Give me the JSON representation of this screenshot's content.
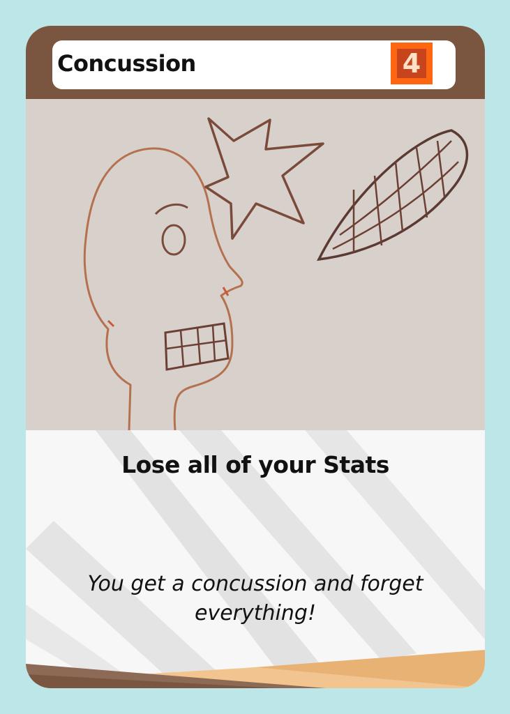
{
  "card": {
    "title": "Concussion",
    "cost": "4",
    "effect": "Lose all of your Stats",
    "flavor": "You get a concussion and forget everything!",
    "artwork_icon": "head-star-football-drawing-icon"
  },
  "colors": {
    "background": "#bde6e8",
    "header": "#7a5640",
    "cost": "#ff6611",
    "footer_tan": "#e9b275",
    "footer_brown": "#7a5640"
  }
}
